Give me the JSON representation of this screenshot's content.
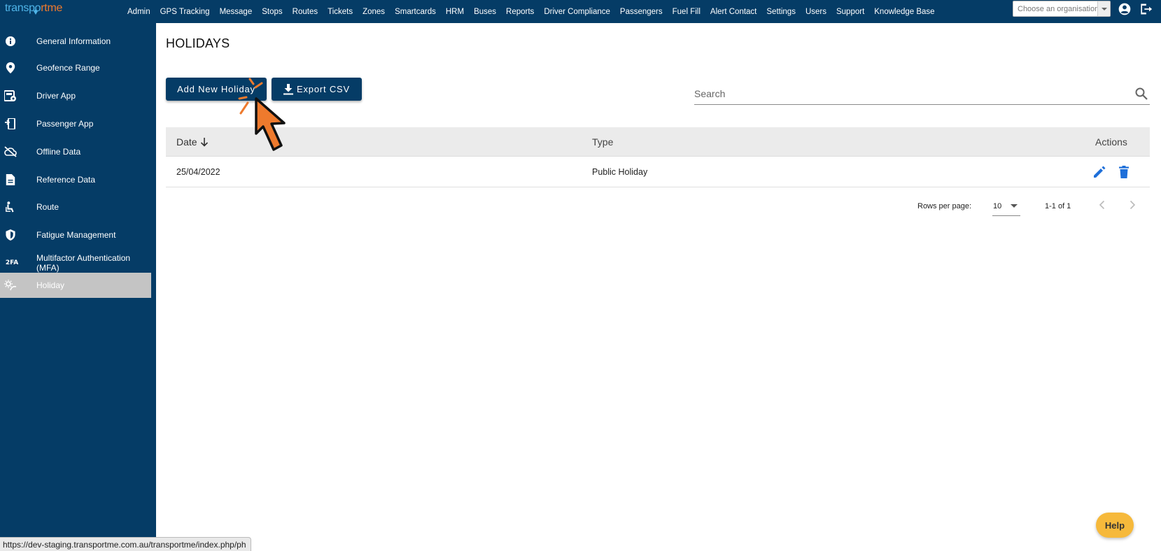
{
  "app": {
    "logo_part1": "transp",
    "logo_part2": "rtme",
    "brand_color": "#053c66",
    "accent_color": "#ee7a2d"
  },
  "nav": {
    "items": [
      "Admin",
      "GPS Tracking",
      "Message",
      "Stops",
      "Routes",
      "Tickets",
      "Zones",
      "Smartcards",
      "HRM",
      "Buses",
      "Reports",
      "Driver Compliance",
      "Passengers",
      "Fuel Fill",
      "Alert Contact",
      "Settings",
      "Users",
      "Support",
      "Knowledge Base"
    ],
    "org_placeholder": "Choose an organisation"
  },
  "sidebar": {
    "items": [
      {
        "label": "General Information",
        "icon": "info-icon"
      },
      {
        "label": "Geofence Range",
        "icon": "location-pin-icon"
      },
      {
        "label": "Driver App",
        "icon": "driver-app-icon"
      },
      {
        "label": "Passenger App",
        "icon": "passenger-app-icon"
      },
      {
        "label": "Offline Data",
        "icon": "cloud-off-icon"
      },
      {
        "label": "Reference Data",
        "icon": "document-icon"
      },
      {
        "label": "Route",
        "icon": "route-icon"
      },
      {
        "label": "Fatigue Management",
        "icon": "shield-icon"
      },
      {
        "label": "Multifactor Authentication (MFA)",
        "icon": "2fa-icon"
      },
      {
        "label": "Holiday",
        "icon": "holiday-icon",
        "active": true
      }
    ]
  },
  "main": {
    "title": "HOLIDAYS",
    "add_button": "Add New Holiday",
    "export_button": "Export CSV",
    "search_placeholder": "Search"
  },
  "table": {
    "columns": {
      "date": "Date",
      "type": "Type",
      "actions": "Actions"
    },
    "rows": [
      {
        "date": "25/04/2022",
        "type": "Public Holiday"
      }
    ]
  },
  "pagination": {
    "rows_per_page_label": "Rows per page:",
    "rows_per_page": "10",
    "range": "1-1 of 1"
  },
  "help": {
    "label": "Help"
  },
  "status_bar": {
    "url": "https://dev-staging.transportme.com.au/transportme/index.php/ph"
  }
}
